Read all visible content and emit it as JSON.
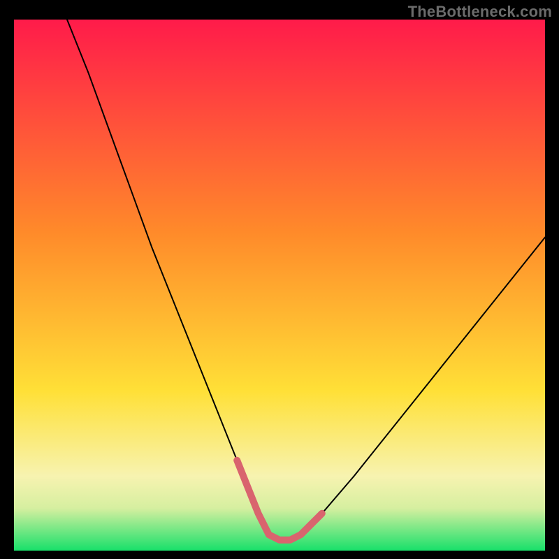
{
  "page": {
    "watermark": "TheBottleneck.com"
  },
  "chart_data": {
    "type": "line",
    "title": "",
    "xlabel": "",
    "ylabel": "",
    "xlim": [
      0,
      100
    ],
    "ylim": [
      0,
      100
    ],
    "grid": false,
    "legend": false,
    "background_gradient": {
      "top_color": "#ff1b4a",
      "mid_color": "#ffe037",
      "bottom_color": "#18e06a",
      "midpoint_y": 30
    },
    "series": [
      {
        "name": "bottleneck-curve",
        "stroke": "#000000",
        "stroke_width": 2,
        "x": [
          10,
          14,
          18,
          22,
          26,
          30,
          34,
          38,
          42,
          44,
          46,
          48,
          50,
          52,
          54,
          58,
          64,
          72,
          80,
          88,
          96,
          100
        ],
        "values": [
          100,
          90,
          79,
          68,
          57,
          47,
          37,
          27,
          17,
          12,
          7,
          3,
          2,
          2,
          3,
          7,
          14,
          24,
          34,
          44,
          54,
          59
        ]
      },
      {
        "name": "highlight-segment",
        "stroke": "#d9646e",
        "stroke_width": 10,
        "x": [
          42,
          44,
          46,
          48,
          50,
          52,
          54,
          58
        ],
        "values": [
          17,
          12,
          7,
          3,
          2,
          2,
          3,
          7
        ]
      }
    ]
  }
}
